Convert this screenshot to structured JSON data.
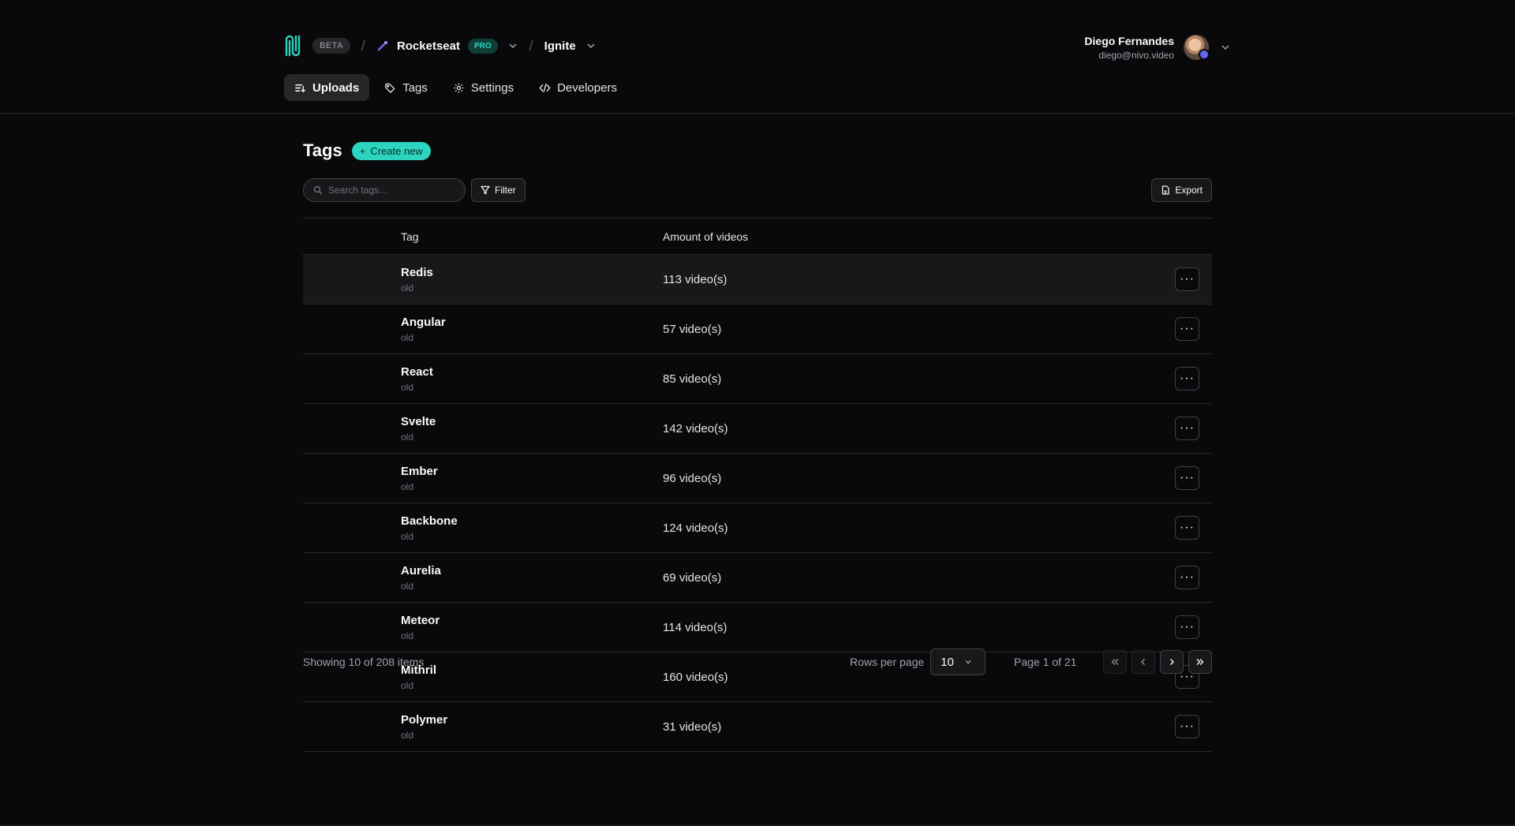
{
  "header": {
    "beta_label": "BETA",
    "org_name": "Rocketseat",
    "pro_label": "PRO",
    "project_name": "Ignite",
    "separator": "/",
    "user": {
      "name": "Diego Fernandes",
      "email": "diego@nivo.video"
    },
    "nav": [
      {
        "label": "Uploads",
        "icon": "uploads-icon",
        "active": true
      },
      {
        "label": "Tags",
        "icon": "tag-icon"
      },
      {
        "label": "Settings",
        "icon": "gear-icon"
      },
      {
        "label": "Developers",
        "icon": "code-icon"
      }
    ]
  },
  "main": {
    "title": "Tags",
    "create_label": "Create new",
    "search_placeholder": "Search tags...",
    "filter_label": "Filter",
    "export_label": "Export",
    "columns": {
      "tag": "Tag",
      "amount": "Amount of videos"
    },
    "rows": [
      {
        "name": "Redis",
        "sub": "old",
        "count": "113 video(s)"
      },
      {
        "name": "Angular",
        "sub": "old",
        "count": "57 video(s)"
      },
      {
        "name": "React",
        "sub": "old",
        "count": "85 video(s)"
      },
      {
        "name": "Svelte",
        "sub": "old",
        "count": "142 video(s)"
      },
      {
        "name": "Ember",
        "sub": "old",
        "count": "96 video(s)"
      },
      {
        "name": "Backbone",
        "sub": "old",
        "count": "124 video(s)"
      },
      {
        "name": "Aurelia",
        "sub": "old",
        "count": "69 video(s)"
      },
      {
        "name": "Meteor",
        "sub": "old",
        "count": "114 video(s)"
      },
      {
        "name": "Mithril",
        "sub": "old",
        "count": "160 video(s)"
      },
      {
        "name": "Polymer",
        "sub": "old",
        "count": "31 video(s)"
      }
    ],
    "more_label": "···"
  },
  "footer": {
    "showing": "Showing 10 of 208 items",
    "rows_per_page_label": "Rows per page",
    "rows_per_page_value": "10",
    "page_info": "Page 1 of 21"
  },
  "colors": {
    "accent": "#2dd4bf",
    "background": "#09090b",
    "border": "#27272a"
  }
}
